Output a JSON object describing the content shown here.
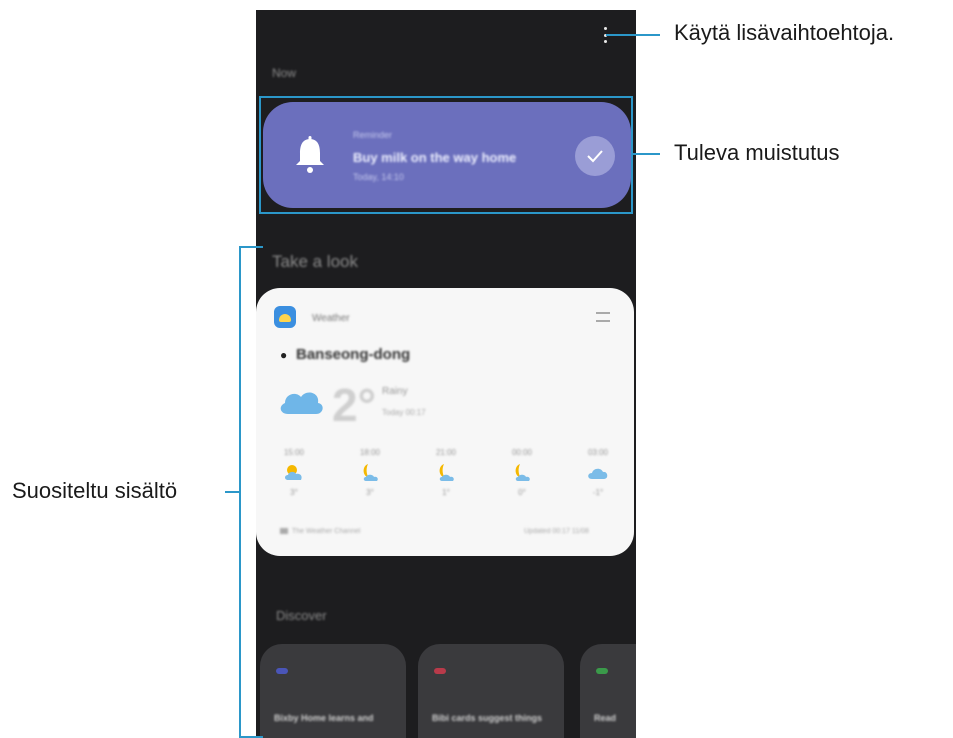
{
  "phone": {
    "section_now": "Now",
    "reminder": {
      "category": "Reminder",
      "title": "Buy milk on the way home",
      "time": "Today, 14:10"
    },
    "section_take_a_look": "Take a look",
    "weather": {
      "app_name": "Weather",
      "location": "Banseong-dong",
      "temperature": "2°",
      "condition": "Rainy",
      "date": "Today 00:17",
      "hours": [
        {
          "time": "15:00",
          "icon": "sunny-cloud-icon",
          "temp": "3°"
        },
        {
          "time": "18:00",
          "icon": "moon-icon",
          "temp": "3°"
        },
        {
          "time": "21:00",
          "icon": "moon-icon",
          "temp": "1°"
        },
        {
          "time": "00:00",
          "icon": "moon-icon",
          "temp": "0°"
        },
        {
          "time": "03:00",
          "icon": "cloud-icon",
          "temp": "-1°"
        }
      ],
      "footer_left": "The Weather Channel",
      "footer_right": "Updated 00:17 11/08"
    },
    "section_discover": "Discover",
    "discover": [
      {
        "text": "Bixby Home learns and",
        "color": "#4a55b8"
      },
      {
        "text": "Bibi cards suggest things",
        "color": "#b83a4a"
      },
      {
        "text": "Read",
        "color": "#3a9a4a"
      }
    ]
  },
  "callouts": {
    "more_options": "Käytä lisävaihtoehtoja.",
    "upcoming_reminder": "Tuleva muistutus",
    "recommended_content": "Suositeltu sisältö"
  },
  "colors": {
    "accent_line": "#2b97c9",
    "reminder_card": "#6b6fbd",
    "phone_background": "#1d1d1f"
  }
}
